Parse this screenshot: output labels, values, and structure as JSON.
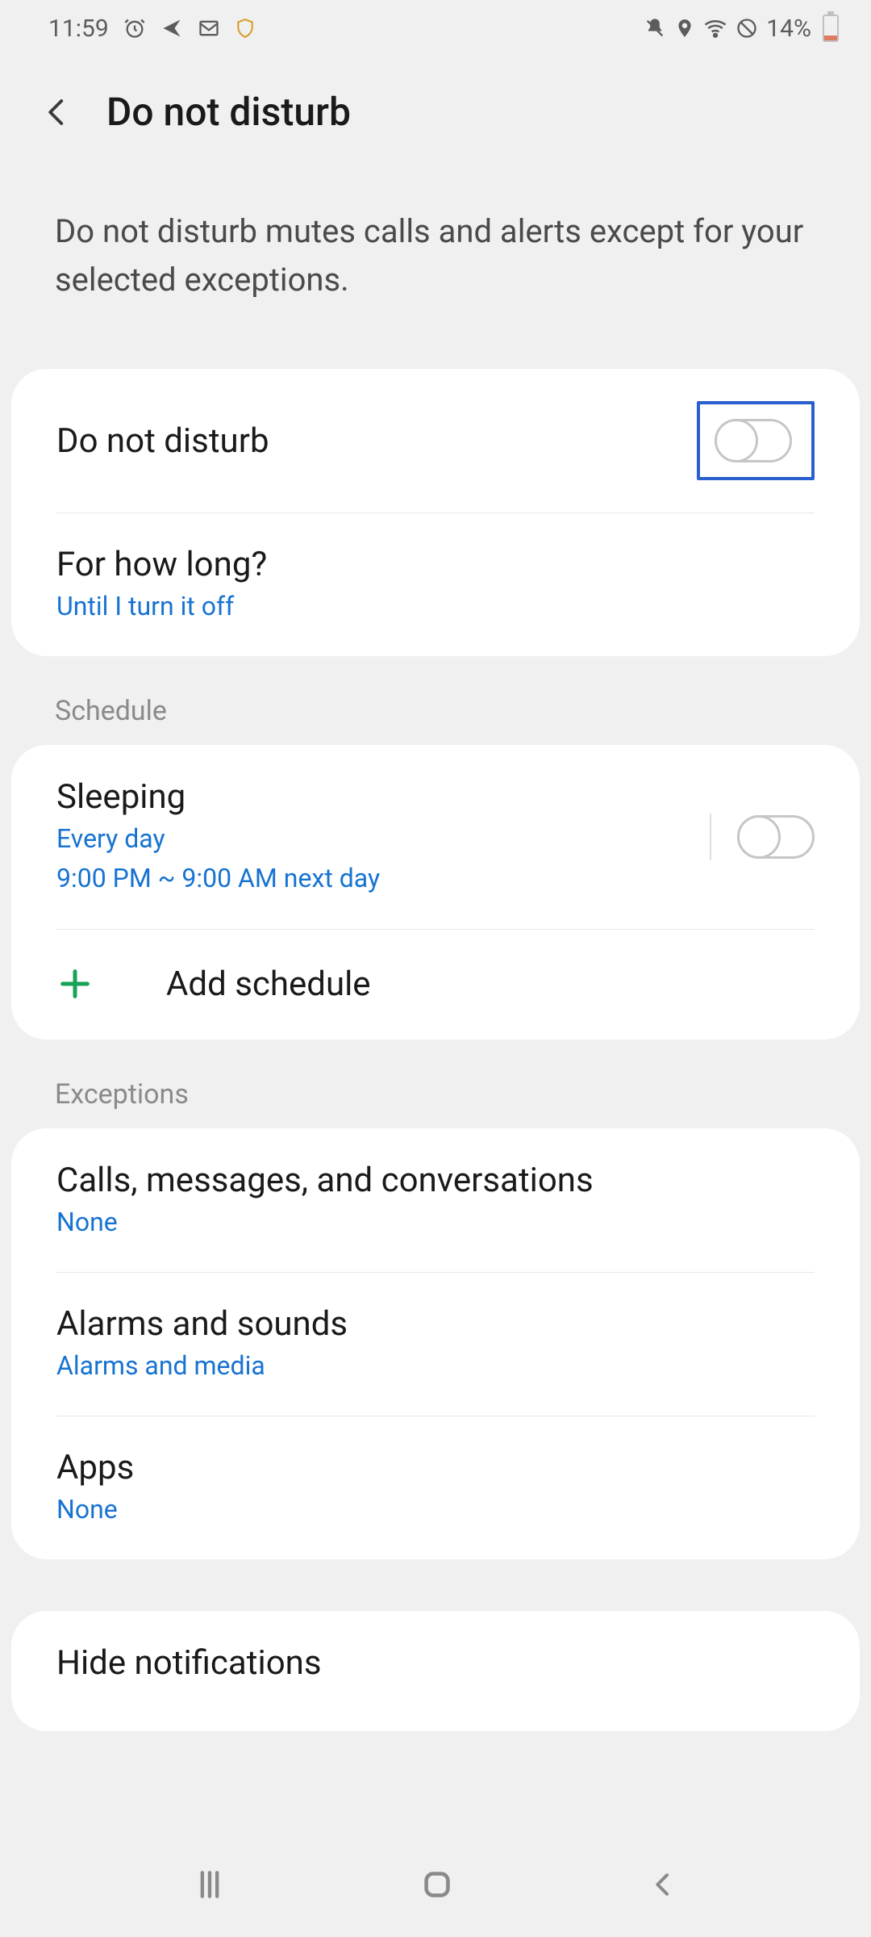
{
  "status_bar": {
    "time": "11:59",
    "battery_text": "14%"
  },
  "app_bar": {
    "title": "Do not disturb"
  },
  "description": "Do not disturb mutes calls and alerts except for your selected exceptions.",
  "main_toggle": {
    "label": "Do not disturb"
  },
  "duration": {
    "label": "For how long?",
    "value": "Until I turn it off"
  },
  "sections": {
    "schedule": "Schedule",
    "exceptions": "Exceptions"
  },
  "schedule": {
    "sleeping": {
      "title": "Sleeping",
      "line1": "Every day",
      "line2": "9:00 PM ~ 9:00 AM next day"
    },
    "add_label": "Add schedule"
  },
  "exceptions": {
    "calls": {
      "title": "Calls, messages, and conversations",
      "value": "None"
    },
    "alarms": {
      "title": "Alarms and sounds",
      "value": "Alarms and media"
    },
    "apps": {
      "title": "Apps",
      "value": "None"
    }
  },
  "hide_notifications": {
    "title": "Hide notifications"
  }
}
